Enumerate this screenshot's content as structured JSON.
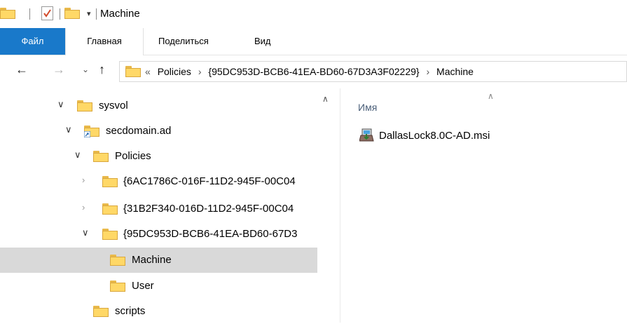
{
  "window": {
    "title": "Machine"
  },
  "ribbon": {
    "file": "Файл",
    "home": "Главная",
    "share": "Поделиться",
    "view": "Вид"
  },
  "address": {
    "overflow": "«",
    "crumbs": [
      "Policies",
      "{95DC953D-BCB6-41EA-BD60-67D3A3F02229}",
      "Machine"
    ],
    "sep": "›"
  },
  "tree": {
    "items": [
      {
        "label": "sysvol",
        "state": "expanded"
      },
      {
        "label": "secdomain.ad",
        "state": "expanded"
      },
      {
        "label": "Policies",
        "state": "expanded"
      },
      {
        "label": "{6AC1786C-016F-11D2-945F-00C04",
        "state": "collapsed"
      },
      {
        "label": "{31B2F340-016D-11D2-945F-00C04",
        "state": "collapsed"
      },
      {
        "label": "{95DC953D-BCB6-41EA-BD60-67D3",
        "state": "expanded"
      },
      {
        "label": "Machine",
        "state": "selected"
      },
      {
        "label": "User",
        "state": "leaf"
      },
      {
        "label": "scripts",
        "state": "leaf"
      }
    ]
  },
  "content": {
    "column_name": "Имя",
    "files": [
      {
        "name": "DallasLock8.0C-AD.msi",
        "icon": "msi-installer-icon"
      }
    ]
  },
  "colors": {
    "accent": "#1979ca",
    "selection": "#d9d9d9",
    "folder": "#ffd867"
  }
}
